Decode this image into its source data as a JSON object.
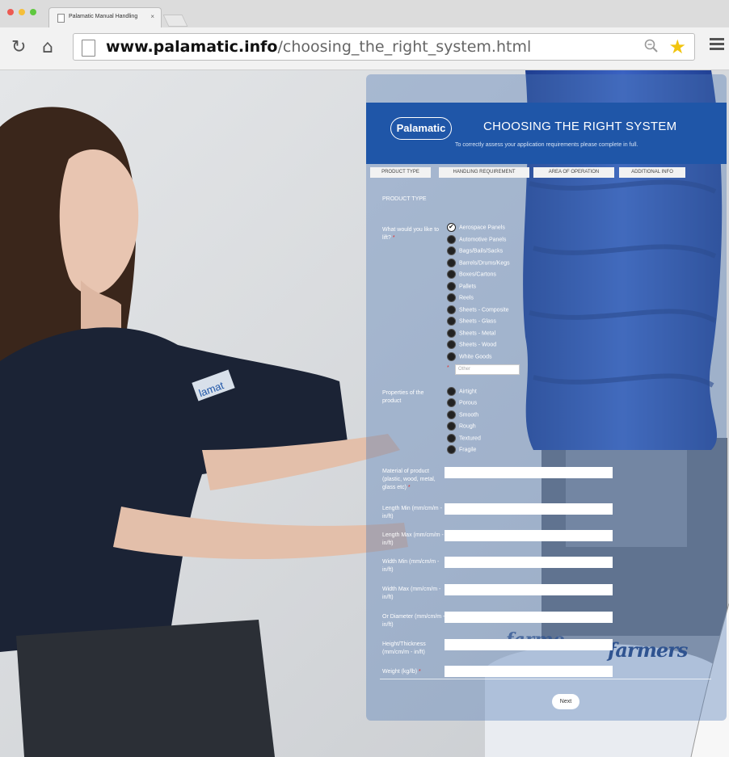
{
  "browser": {
    "tab_title": "Palamatic Manual Handling",
    "tab_close": "×",
    "url_domain": "www.palamatic.info",
    "url_path": "/choosing_the_right_system.html",
    "controls": {
      "reload": "↻",
      "home": "⌂",
      "zoom": "🔍",
      "star": "★"
    },
    "window_dot_colors": [
      "#ed5a52",
      "#f5bf3a",
      "#5fc83f"
    ]
  },
  "form": {
    "logo": "Palamatic",
    "title": "CHOOSING THE RIGHT SYSTEM",
    "subtitle": "To correctly assess your application requirements please complete in full.",
    "steps": [
      "PRODUCT TYPE",
      "HANDLING REQUIREMENT",
      "AREA OF OPERATION",
      "ADDITIONAL INFO"
    ],
    "section_title": "PRODUCT TYPE",
    "q_lift": {
      "label": "What would you like to lift?",
      "options": [
        "Aerospace Panels",
        "Automotive Panels",
        "Bags/Bails/Sacks",
        "Barrels/Drums/Kegs",
        "Boxes/Cartons",
        "Pallets",
        "Reels",
        "Sheets - Composite",
        "Sheets - Glass",
        "Sheets - Metal",
        "Sheets - Wood",
        "White Goods"
      ],
      "selected": "Aerospace Panels",
      "other_placeholder": "Other"
    },
    "q_properties": {
      "label": "Properties of the product",
      "options": [
        "Airtight",
        "Porous",
        "Smooth",
        "Rough",
        "Textured",
        "Fragile"
      ]
    },
    "fields": [
      {
        "label": "Material of product (plastic, wood, metal, glass etc)"
      },
      {
        "label": "Length Min (mm/cm/m - in/ft)"
      },
      {
        "label": "Length Max (mm/cm/m - in/ft)"
      },
      {
        "label": "Width Min (mm/cm/m - in/ft)"
      },
      {
        "label": "Width Max (mm/cm/m - in/ft)"
      },
      {
        "label": "Or Diameter (mm/cm/m - in/ft)"
      },
      {
        "label": "Height/Thickness (mm/cm/m - in/ft)"
      },
      {
        "label": "Weight (kg/lb)"
      }
    ],
    "required_mark": "*",
    "next_label": "Next"
  },
  "photo": {
    "shirt_logo": "lamat",
    "bag_brand": "farmers",
    "bag_brand_partial": "farme"
  },
  "colors": {
    "header_blue": "#1f56a8",
    "hose_blue": "#2f52a8",
    "shirt_navy": "#1b2335"
  }
}
